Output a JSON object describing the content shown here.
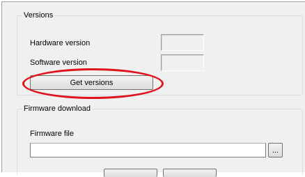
{
  "versions": {
    "legend": "Versions",
    "hardware_label": "Hardware version",
    "hardware_value": "",
    "software_label": "Software version",
    "software_value": "",
    "get_button": "Get versions"
  },
  "firmware": {
    "legend": "Firmware download",
    "file_label": "Firmware file",
    "file_value": "",
    "browse_button": "..."
  },
  "annotation": {
    "color": "#e0121b"
  }
}
